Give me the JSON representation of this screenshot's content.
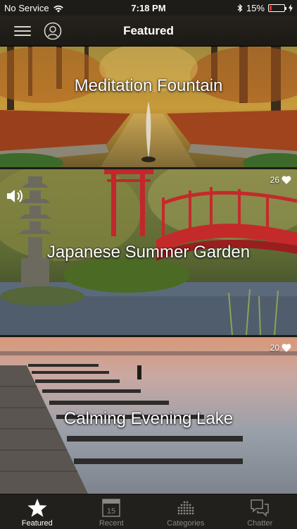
{
  "status_bar": {
    "carrier": "No Service",
    "time": "7:18 PM",
    "battery_percent": "15%",
    "battery_level": 0.15,
    "battery_color": "#e0352b"
  },
  "nav": {
    "title": "Featured",
    "menu_icon": "hamburger-icon",
    "profile_icon": "user-icon"
  },
  "cards": [
    {
      "title": "Meditation Fountain"
    },
    {
      "title": "Japanese Summer Garden",
      "likes": "26",
      "sound_icon": "speaker-icon"
    },
    {
      "title": "Calming Evening Lake",
      "likes": "20"
    }
  ],
  "tabs": [
    {
      "label": "Featured",
      "icon": "star-icon",
      "active": true
    },
    {
      "label": "Recent",
      "icon": "calendar-icon",
      "calendar_day": "15"
    },
    {
      "label": "Categories",
      "icon": "categories-icon"
    },
    {
      "label": "Chatter",
      "icon": "chat-bubbles-icon"
    }
  ]
}
